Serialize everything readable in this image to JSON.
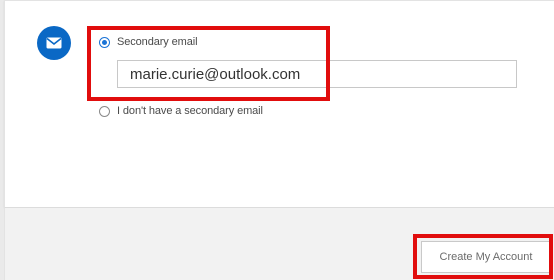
{
  "form": {
    "icon": "envelope-icon",
    "icon_color": "#0a68c5",
    "options": {
      "secondary_email_label": "Secondary email",
      "no_secondary_email_label": "I don't have a secondary email"
    },
    "secondary_email_value": "marie.curie@outlook.com",
    "selected_option": "secondary_email"
  },
  "footer": {
    "create_account_label": "Create My Account"
  },
  "highlight_color": "#e10d0d"
}
